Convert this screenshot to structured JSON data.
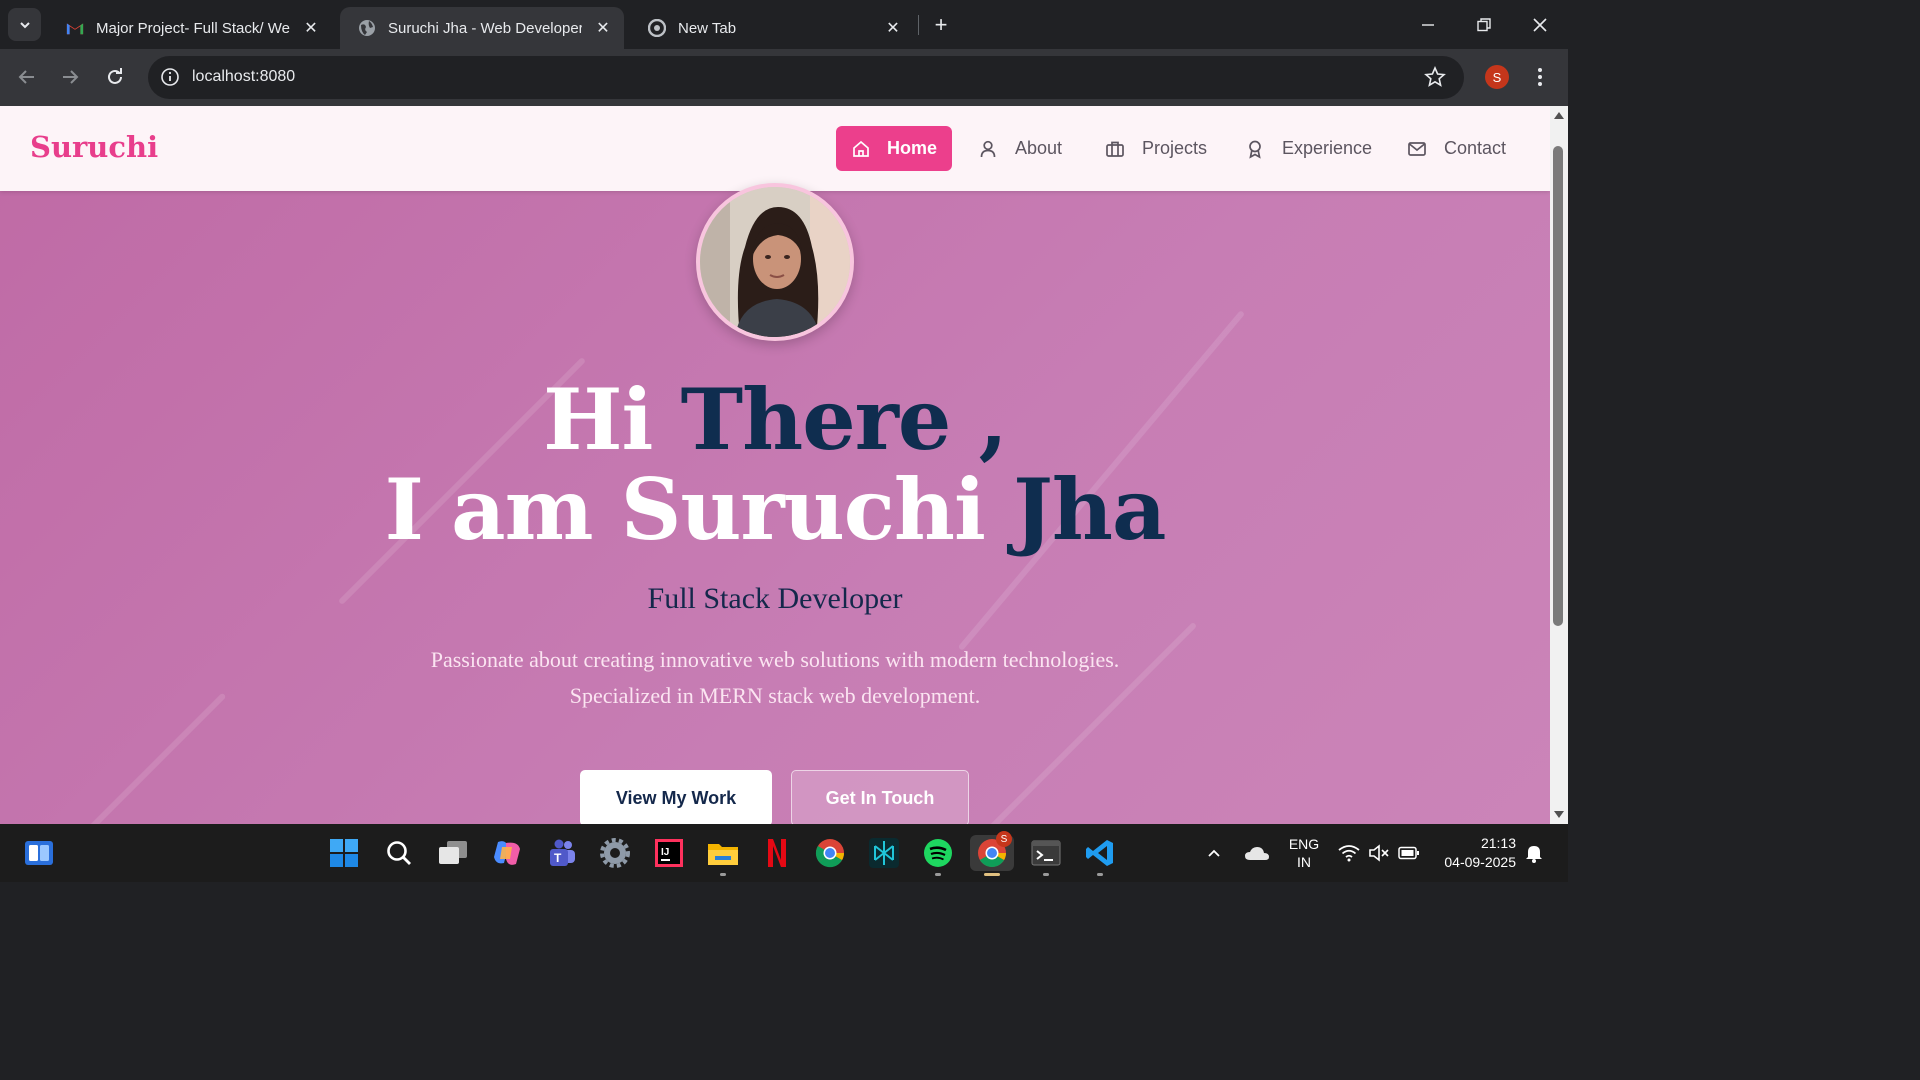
{
  "browser": {
    "tabs": [
      {
        "title": "Major Project- Full Stack/ Web I",
        "icon": "gmail-icon"
      },
      {
        "title": "Suruchi Jha - Web Developer Po",
        "icon": "globe-icon"
      },
      {
        "title": "New Tab",
        "icon": "chrome-icon"
      }
    ],
    "url": "localhost:8080",
    "profile_initial": "S"
  },
  "page": {
    "brand": "Suruchi",
    "nav": [
      {
        "label": "Home",
        "icon": "home-icon",
        "active": true
      },
      {
        "label": "About",
        "icon": "user-icon"
      },
      {
        "label": "Projects",
        "icon": "briefcase-icon"
      },
      {
        "label": "Experience",
        "icon": "award-icon"
      },
      {
        "label": "Contact",
        "icon": "mail-icon"
      }
    ],
    "hero": {
      "line1_white": "Hi",
      "line1_navy": "There ,",
      "line2_white": "I am Suruchi",
      "line2_navy": "Jha",
      "role": "Full Stack Developer",
      "desc_line1": "Passionate about creating innovative web solutions with modern technologies.",
      "desc_line2": "Specialized in MERN stack web development.",
      "primary_button": "View My Work",
      "secondary_button": "Get In Touch"
    },
    "colors": {
      "accent": "#ec3f8c",
      "navy": "#0f2d4f",
      "hero_bg": "#c77db4"
    }
  },
  "taskbar": {
    "apps": [
      "widgets-icon",
      "start-icon",
      "search-icon",
      "task-view-icon",
      "copilot-icon",
      "teams-icon",
      "settings-icon",
      "intellij-icon",
      "file-explorer-icon",
      "netflix-icon",
      "chrome-icon",
      "perplexity-icon",
      "spotify-icon",
      "chrome-profile-icon",
      "terminal-icon",
      "vscode-icon"
    ],
    "chrome_badge": "S",
    "lang_line1": "ENG",
    "lang_line2": "IN",
    "time": "21:13",
    "date": "04-09-2025"
  }
}
